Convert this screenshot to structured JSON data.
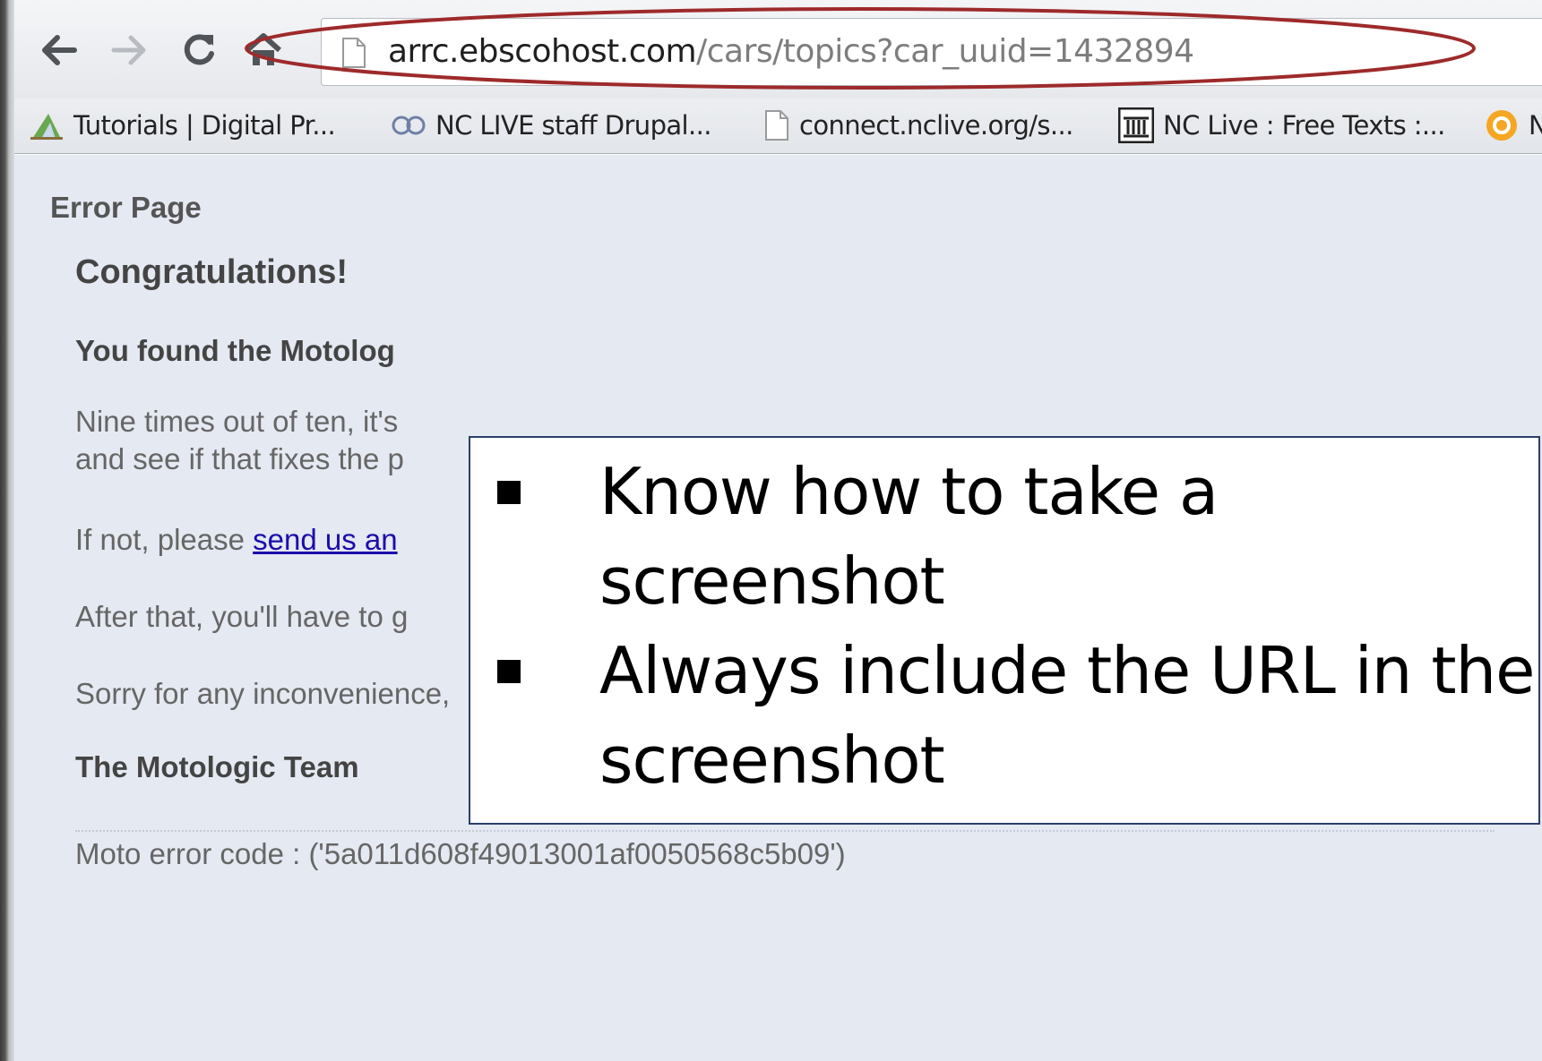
{
  "browser": {
    "address_bar": {
      "url_host": "arrc.ebscohost.com",
      "url_path": "/cars/topics?car_uuid=1432894"
    },
    "nav_icons": [
      "back-arrow-icon",
      "forward-arrow-icon",
      "reload-icon",
      "home-icon",
      "page-icon"
    ],
    "bookmarks": [
      {
        "label": "Tutorials | Digital Pr...",
        "icon": "tutorial-icon"
      },
      {
        "label": "NC LIVE staff Drupal...",
        "icon": "drupal-icon"
      },
      {
        "label": "connect.nclive.org/s...",
        "icon": "page-icon"
      },
      {
        "label": "NC Live : Free Texts :...",
        "icon": "library-icon"
      },
      {
        "label": "N",
        "icon": "orange-circle-icon"
      }
    ],
    "highlight_color": "#9e2a2b"
  },
  "page": {
    "error_title": "Error Page",
    "congrats": "Congratulations!",
    "found_text": "You found the Motolog",
    "para_1": "Nine times out of ten, it's",
    "para_2": "and see if that fixes the p",
    "para_3_prefix": "If not, please ",
    "para_3_link": "send us an",
    "para_4": "After that, you'll have to g",
    "sorry": "Sorry for any inconvenience,",
    "team": "The Motologic Team",
    "error_code": "Moto error code : ('5a011d608f49013001af0050568c5b09')"
  },
  "callout": {
    "bullets": [
      "Know how to take a screenshot",
      "Always include the URL in the screenshot"
    ]
  }
}
